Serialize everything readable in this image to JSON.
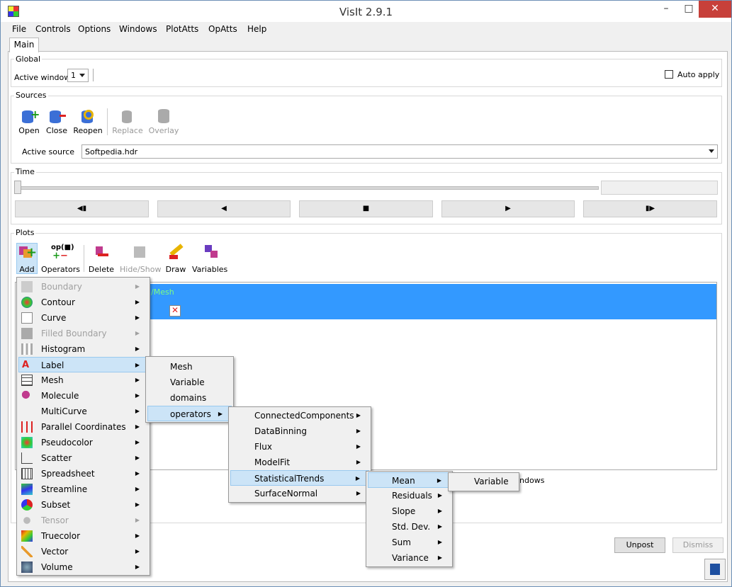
{
  "window": {
    "title": "VisIt 2.9.1",
    "minimize": "–",
    "maximize": "□",
    "close": "✕"
  },
  "menubar": [
    "File",
    "Controls",
    "Options",
    "Windows",
    "PlotAtts",
    "OpAtts",
    "Help"
  ],
  "tab": "Main",
  "global": {
    "label": "Global",
    "active_window_label": "Active window",
    "active_window_value": "1",
    "auto_apply": "Auto apply"
  },
  "sources": {
    "label": "Sources",
    "buttons": [
      "Open",
      "Close",
      "Reopen",
      "Replace",
      "Overlay"
    ],
    "active_source_label": "Active source",
    "active_source_value": "Softpedia.hdr"
  },
  "time": {
    "label": "Time",
    "vcr": [
      "◀▮",
      "◀",
      "■",
      "▶",
      "▮▶"
    ]
  },
  "plots": {
    "label": "Plots",
    "toolbar": [
      "Add",
      "Operators",
      "Delete",
      "Hide/Show",
      "Draw",
      "Variables"
    ],
    "operators_icon_text": "op(■)",
    "row1_text": "/Mesh"
  },
  "add_menu": [
    {
      "label": "Boundary",
      "disabled": true
    },
    {
      "label": "Contour",
      "disabled": false
    },
    {
      "label": "Curve",
      "disabled": false
    },
    {
      "label": "Filled Boundary",
      "disabled": true
    },
    {
      "label": "Histogram",
      "disabled": false
    },
    {
      "label": "Label",
      "disabled": false
    },
    {
      "label": "Mesh",
      "disabled": false
    },
    {
      "label": "Molecule",
      "disabled": false
    },
    {
      "label": "MultiCurve",
      "disabled": false
    },
    {
      "label": "Parallel Coordinates",
      "disabled": false
    },
    {
      "label": "Pseudocolor",
      "disabled": false
    },
    {
      "label": "Scatter",
      "disabled": false
    },
    {
      "label": "Spreadsheet",
      "disabled": false
    },
    {
      "label": "Streamline",
      "disabled": false
    },
    {
      "label": "Subset",
      "disabled": false
    },
    {
      "label": "Tensor",
      "disabled": true
    },
    {
      "label": "Truecolor",
      "disabled": false
    },
    {
      "label": "Vector",
      "disabled": false
    },
    {
      "label": "Volume",
      "disabled": false
    }
  ],
  "label_menu": [
    "Mesh",
    "Variable",
    "domains",
    "operators"
  ],
  "operators_menu": [
    "ConnectedComponents",
    "DataBinning",
    "Flux",
    "ModelFit",
    "StatisticalTrends",
    "SurfaceNormal"
  ],
  "trends_menu": [
    "Mean",
    "Residuals",
    "Slope",
    "Std. Dev.",
    "Sum",
    "Variance"
  ],
  "mean_menu": [
    "Variable"
  ],
  "partial_text": "indows",
  "bottom": {
    "unpost": "Unpost",
    "dismiss": "Dismiss"
  }
}
